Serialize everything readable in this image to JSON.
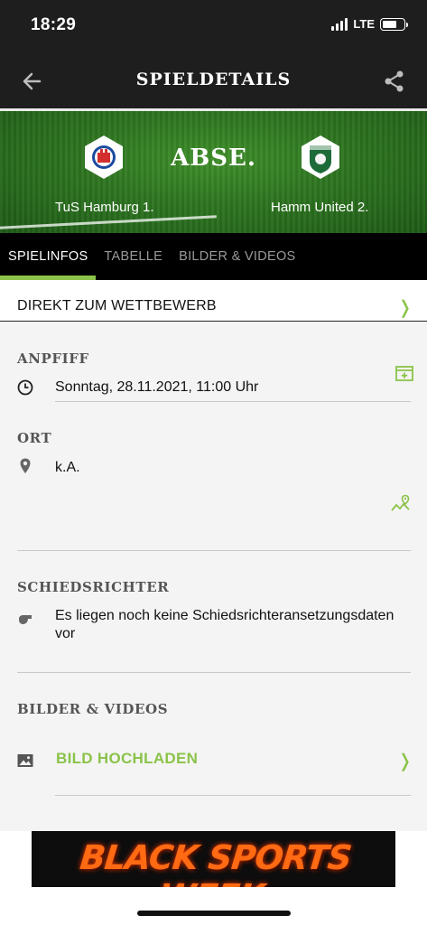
{
  "status_bar": {
    "time": "18:29",
    "network": "LTE"
  },
  "app_bar": {
    "title": "SPIELDETAILS"
  },
  "match": {
    "home_team": "TuS Hamburg 1.",
    "away_team": "Hamm United 2.",
    "status": "ABSE."
  },
  "tabs": [
    {
      "label": "SPIELINFOS",
      "active": true
    },
    {
      "label": "TABELLE",
      "active": false
    },
    {
      "label": "BILDER & VIDEOS",
      "active": false
    }
  ],
  "competition_link": {
    "label": "DIREKT ZUM WETTBEWERB"
  },
  "kickoff": {
    "title": "ANPFIFF",
    "value": "Sonntag, 28.11.2021, 11:00 Uhr"
  },
  "location": {
    "title": "ORT",
    "value": "k.A."
  },
  "referee": {
    "title": "SCHIEDSRICHTER",
    "value_line1": "Es liegen noch keine Schiedsrichteransetzungsdaten",
    "value_line2": "vor"
  },
  "media": {
    "title": "BILDER & VIDEOS",
    "upload_label": "BILD HOCHLADEN"
  },
  "ad": {
    "text": "BLACK SPORTS WEEK"
  },
  "colors": {
    "accent": "#8bc34a",
    "dark": "#1e1e1e"
  }
}
